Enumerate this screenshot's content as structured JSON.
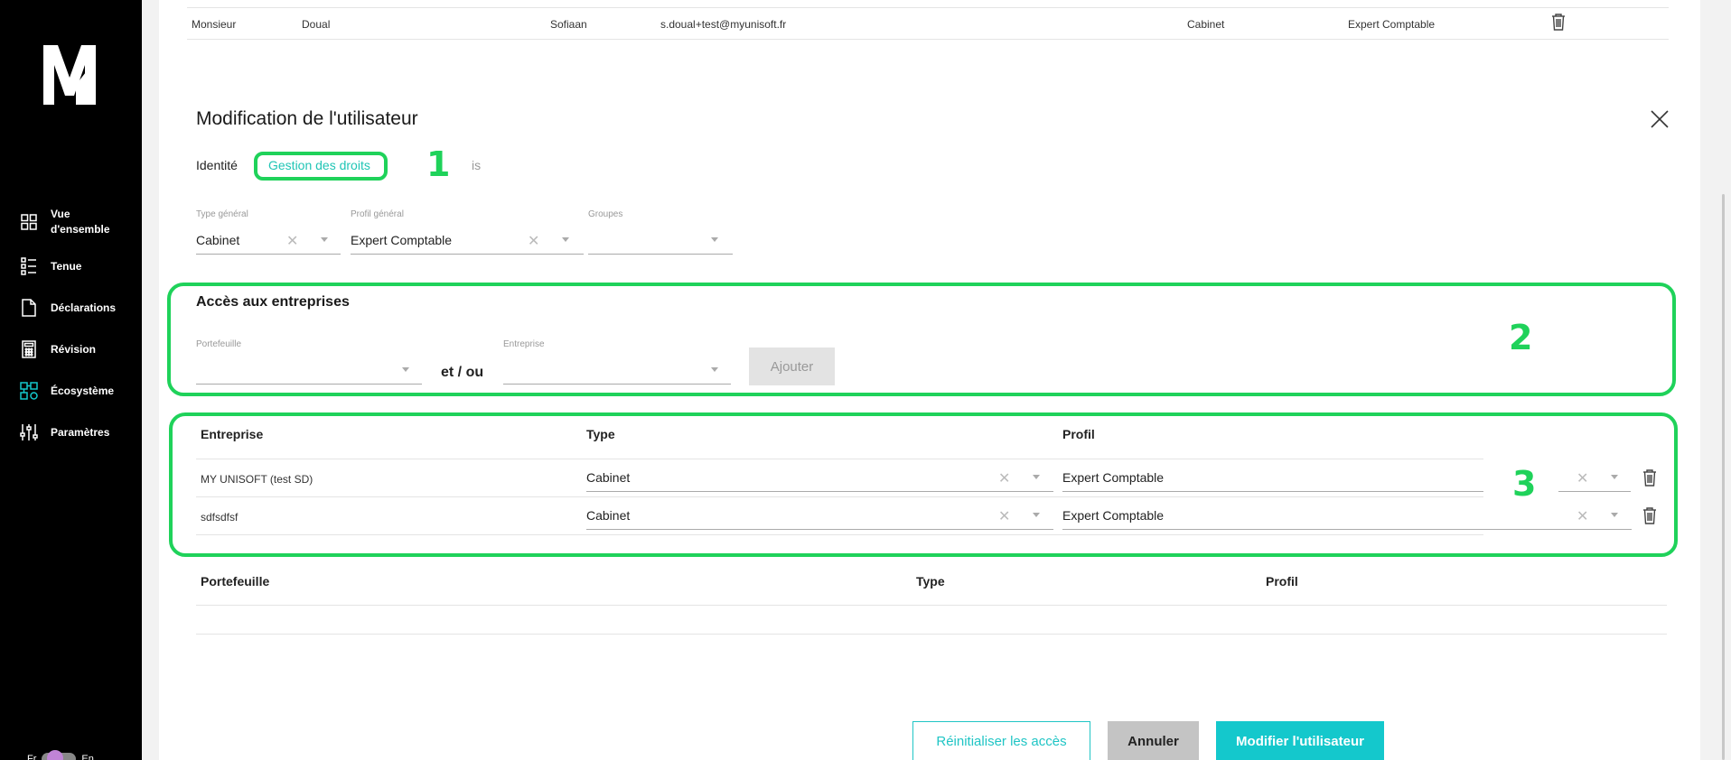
{
  "sidebar": {
    "logo_alt": "M",
    "items": [
      {
        "label": "Vue d'ensemble",
        "icon": "grid-icon"
      },
      {
        "label": "Tenue",
        "icon": "list-icon"
      },
      {
        "label": "Déclarations",
        "icon": "document-icon"
      },
      {
        "label": "Révision",
        "icon": "calculator-icon"
      },
      {
        "label": "Écosystème",
        "icon": "ecosystem-icon"
      },
      {
        "label": "Paramètres",
        "icon": "sliders-icon"
      }
    ],
    "lang_left": "Fr",
    "lang_right": "En"
  },
  "user_row": {
    "civility": "Monsieur",
    "last_name": "Doual",
    "first_name": "Sofiaan",
    "email": "s.doual+test@myunisoft.fr",
    "type": "Cabinet",
    "profile": "Expert Comptable"
  },
  "modal": {
    "title": "Modification de l'utilisateur",
    "tabs": {
      "identite": "Identité",
      "droits": "Gestion des droits",
      "is": "is"
    },
    "markers": [
      "1",
      "2",
      "3"
    ],
    "general": {
      "type_label": "Type général",
      "type_value": "Cabinet",
      "profil_label": "Profil général",
      "profil_value": "Expert Comptable",
      "groupes_label": "Groupes",
      "groupes_value": ""
    },
    "access": {
      "title": "Accès aux entreprises",
      "portefeuille_label": "Portefeuille",
      "entreprise_label": "Entreprise",
      "et_ou": "et / ou",
      "add_button": "Ajouter"
    },
    "company_table": {
      "headers": [
        "Entreprise",
        "Type",
        "Profil"
      ],
      "rows": [
        {
          "entreprise": "MY UNISOFT (test SD)",
          "type": "Cabinet",
          "profil": "Expert Comptable"
        },
        {
          "entreprise": "sdfsdfsf",
          "type": "Cabinet",
          "profil": "Expert Comptable"
        }
      ]
    },
    "portfolio_table": {
      "headers": [
        "Portefeuille",
        "Type",
        "Profil"
      ]
    },
    "buttons": {
      "reset": "Réinitialiser les accès",
      "cancel": "Annuler",
      "submit": "Modifier l'utilisateur"
    }
  },
  "colors": {
    "accent": "#14c8cc",
    "highlight": "#1fd25a",
    "sidebar": "#000000"
  }
}
